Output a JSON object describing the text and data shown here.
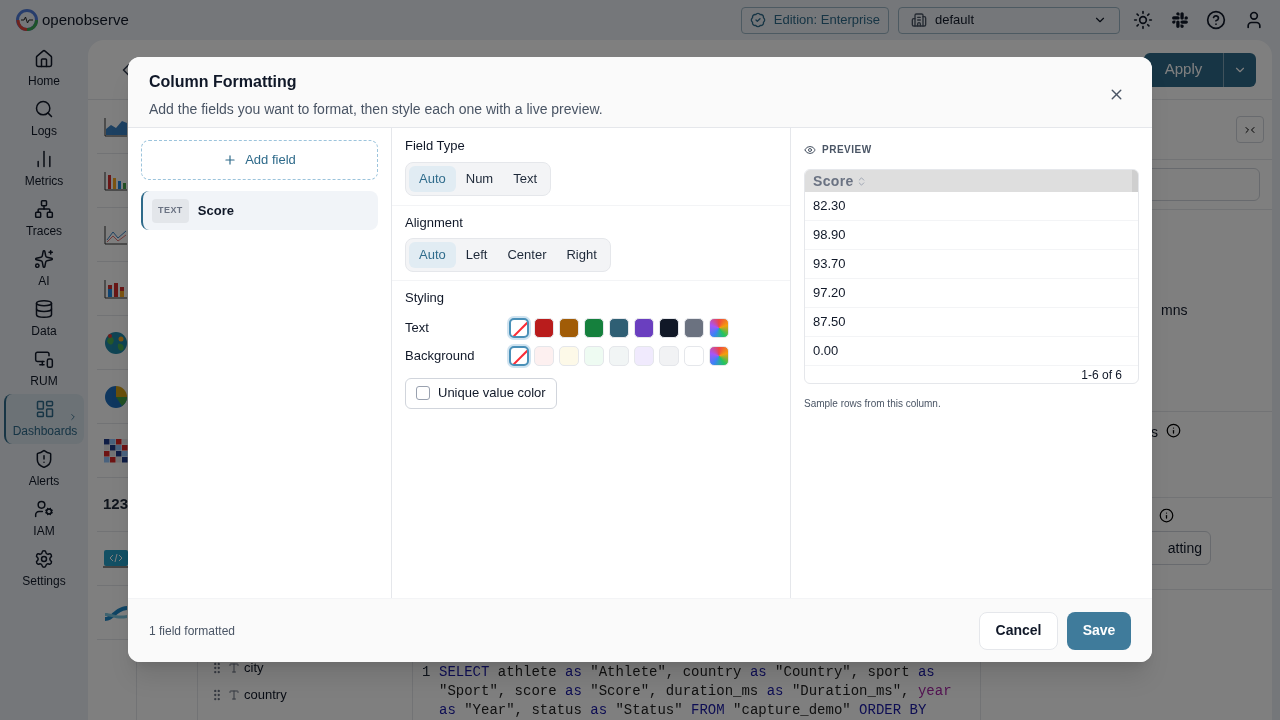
{
  "app": {
    "logo": "openobserve",
    "edition": "Edition: Enterprise",
    "organization": "default"
  },
  "nav": [
    {
      "label": "Home",
      "kind": "home",
      "selected": false
    },
    {
      "label": "Logs",
      "kind": "search",
      "selected": false
    },
    {
      "label": "Metrics",
      "kind": "metrics",
      "selected": false
    },
    {
      "label": "Traces",
      "kind": "traces",
      "selected": false
    },
    {
      "label": "AI",
      "kind": "ai",
      "selected": false
    },
    {
      "label": "Data",
      "kind": "data",
      "selected": false
    },
    {
      "label": "RUM",
      "kind": "rum",
      "selected": false
    },
    {
      "label": "Dashboards",
      "kind": "dashboards",
      "selected": true
    },
    {
      "label": "Alerts",
      "kind": "alerts",
      "selected": false
    },
    {
      "label": "IAM",
      "kind": "iam",
      "selected": false
    },
    {
      "label": "Settings",
      "kind": "settings",
      "selected": false
    }
  ],
  "toolbar": {
    "apply": "Apply"
  },
  "chart_types": [
    {
      "kind": "area"
    },
    {
      "kind": "bar"
    },
    {
      "kind": "line"
    },
    {
      "kind": "stacked"
    },
    {
      "kind": "geo"
    },
    {
      "kind": "pie"
    },
    {
      "kind": "heatmap"
    },
    {
      "kind": "metric",
      "text": "123"
    },
    {
      "kind": "html"
    },
    {
      "kind": "sankey"
    }
  ],
  "fields": [
    "city",
    "country"
  ],
  "query": {
    "line_number": "1",
    "lines": [
      [
        {
          "kind": "keyword",
          "text": "SELECT"
        },
        {
          "kind": "plain",
          "text": " athlete "
        },
        {
          "kind": "keyword",
          "text": "as"
        },
        {
          "kind": "plain",
          "text": " \"Athlete\", country "
        },
        {
          "kind": "keyword",
          "text": "as"
        },
        {
          "kind": "plain",
          "text": " \"Country\", sport "
        },
        {
          "kind": "keyword",
          "text": "as"
        }
      ],
      [
        {
          "kind": "plain",
          "text": "\"Sport\", score "
        },
        {
          "kind": "keyword",
          "text": "as"
        },
        {
          "kind": "plain",
          "text": " \"Score\", duration_ms "
        },
        {
          "kind": "keyword",
          "text": "as"
        },
        {
          "kind": "plain",
          "text": " \"Duration_ms\", "
        },
        {
          "kind": "function",
          "text": "year"
        }
      ],
      [
        {
          "kind": "keyword",
          "text": "as"
        },
        {
          "kind": "plain",
          "text": " \"Year\", status "
        },
        {
          "kind": "keyword",
          "text": "as"
        },
        {
          "kind": "plain",
          "text": " \"Status\" "
        },
        {
          "kind": "keyword",
          "text": "FROM"
        },
        {
          "kind": "plain",
          "text": " \"capture_demo\" "
        },
        {
          "kind": "keyword",
          "text": "ORDER BY"
        }
      ]
    ]
  },
  "config_panel": {
    "fragment_1": "mns",
    "fragment_2": "s",
    "button": "atting"
  },
  "modal": {
    "title": "Column Formatting",
    "subtitle": "Add the fields you want to format, then style each one with a live preview.",
    "add_field": "Add field",
    "fields": [
      {
        "badge": "TEXT",
        "name": "Score",
        "selected": true
      }
    ],
    "field_type": {
      "label": "Field Type",
      "options": [
        {
          "label": "Auto",
          "selected": true
        },
        {
          "label": "Num",
          "selected": false
        },
        {
          "label": "Text",
          "selected": false
        }
      ]
    },
    "alignment": {
      "label": "Alignment",
      "options": [
        {
          "label": "Auto",
          "selected": true
        },
        {
          "label": "Left",
          "selected": false
        },
        {
          "label": "Center",
          "selected": false
        },
        {
          "label": "Right",
          "selected": false
        }
      ]
    },
    "styling": {
      "label": "Styling",
      "rows": [
        {
          "label": "Text",
          "swatches": [
            {
              "kind": "none",
              "selected": true
            },
            {
              "kind": "color",
              "color": "#b91c1c",
              "selected": false
            },
            {
              "kind": "color",
              "color": "#a15c07",
              "selected": false
            },
            {
              "kind": "color",
              "color": "#15803d",
              "selected": false
            },
            {
              "kind": "color",
              "color": "#2f5f74",
              "selected": false
            },
            {
              "kind": "color",
              "color": "#6a3fbf",
              "selected": false
            },
            {
              "kind": "color",
              "color": "#111827",
              "selected": false
            },
            {
              "kind": "color",
              "color": "#6b7280",
              "selected": false
            },
            {
              "kind": "picker",
              "selected": false
            }
          ]
        },
        {
          "label": "Background",
          "swatches": [
            {
              "kind": "none",
              "selected": true
            },
            {
              "kind": "color",
              "color": "#fdf0f0",
              "selected": false
            },
            {
              "kind": "color",
              "color": "#fdf9e8",
              "selected": false
            },
            {
              "kind": "color",
              "color": "#eefbf2",
              "selected": false
            },
            {
              "kind": "color",
              "color": "#f1f5f5",
              "selected": false
            },
            {
              "kind": "color",
              "color": "#f0eafd",
              "selected": false
            },
            {
              "kind": "color",
              "color": "#f1f2f4",
              "selected": false
            },
            {
              "kind": "color",
              "color": "#ffffff",
              "selected": false
            },
            {
              "kind": "picker",
              "selected": false
            }
          ]
        }
      ]
    },
    "unique_value_color": {
      "label": "Unique value color",
      "checked": false
    },
    "preview": {
      "label": "PREVIEW",
      "column": "Score",
      "rows": [
        "82.30",
        "98.90",
        "93.70",
        "97.20",
        "87.50",
        "0.00"
      ],
      "pagination": "1-6 of 6",
      "caption": "Sample rows from this column."
    },
    "footer": {
      "status": "1 field formatted",
      "cancel": "Cancel",
      "save": "Save"
    }
  }
}
